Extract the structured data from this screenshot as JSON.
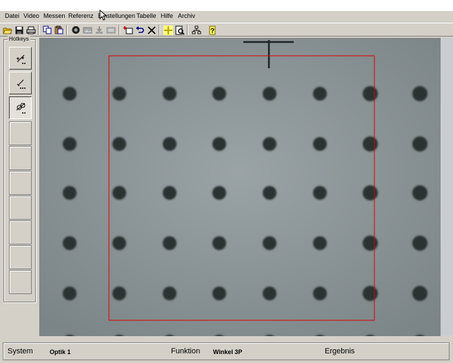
{
  "menu": [
    "Datei",
    "Video",
    "Messen",
    "Referenz",
    "Einstellungen",
    "Tabelle",
    "Hilfe",
    "Archiv"
  ],
  "toolbar_icons": [
    "open-folder-icon",
    "save-icon",
    "print-icon",
    "copy-icon",
    "paste-icon",
    "camera-icon",
    "image-icon",
    "import-icon",
    "export-icon",
    "add-icon",
    "undo-icon",
    "close-x-icon",
    "crosshair-icon",
    "zoom-page-icon",
    "tree-icon",
    "help-icon"
  ],
  "hotkeys": {
    "label": "Hotkeys",
    "buttons": [
      "measure-point-icon",
      "measure-line-icon",
      "measure-distance-icon"
    ]
  },
  "status": {
    "system_label": "System",
    "system_value": "Optik 1",
    "function_label": "Funktion",
    "function_value": "Winkel 3P",
    "result_label": "Ergebnis",
    "result_value": ""
  },
  "colors": {
    "roi": "#e00000",
    "dot": "#2b3033",
    "camera_bg": "#8b9496",
    "ui_face": "#d4d0c8"
  }
}
